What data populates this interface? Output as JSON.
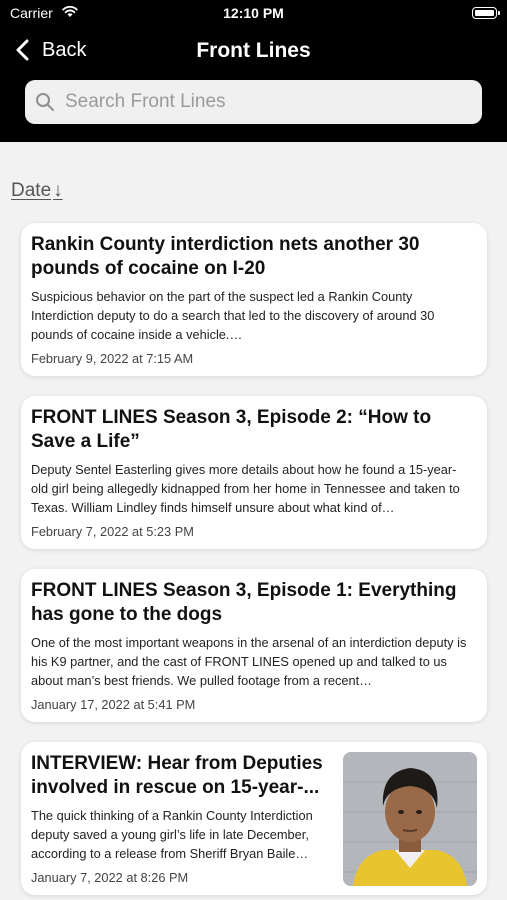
{
  "status_bar": {
    "carrier": "Carrier",
    "time": "12:10 PM"
  },
  "nav": {
    "back_label": "Back",
    "title": "Front Lines"
  },
  "search": {
    "placeholder": "Search Front Lines"
  },
  "sort": {
    "label": "Date",
    "arrow": "↓"
  },
  "articles": [
    {
      "title": "Rankin County interdiction nets another 30 pounds of cocaine on I-20",
      "summary": "Suspicious behavior on the part of the suspect led a Rankin County Interdiction deputy to do a search that led to the discovery of around 30 pounds of cocaine inside a vehicle.…",
      "date": "February 9, 2022 at 7:15 AM"
    },
    {
      "title": "FRONT LINES Season 3, Episode 2: “How to Save a Life”",
      "summary": "Deputy Sentel Easterling gives more details about how he found a 15-year-old girl being allegedly kidnapped from her home in Tennessee and taken to Texas. William Lindley finds himself unsure about what kind of…",
      "date": "February 7, 2022 at 5:23 PM"
    },
    {
      "title": "FRONT LINES Season 3, Episode 1: Everything has gone to the dogs",
      "summary": "One of the most important weapons in the arsenal of an interdiction deputy is his K9 partner, and the cast of FRONT LINES opened up and talked to us about man’s best friends. We pulled footage from a recent…",
      "date": "January 17, 2022 at 5:41 PM"
    },
    {
      "title": "INTERVIEW: Hear from Deputies involved in rescue on 15-year-...",
      "summary": "The quick thinking of a Rankin County Interdiction deputy saved a young girl’s life in late December, according to a release from Sheriff Bryan Baile…",
      "date": "January 7, 2022 at 8:26 PM"
    }
  ],
  "colors": {
    "header_bg": "#000000",
    "page_bg": "#f2f2f2",
    "card_bg": "#ffffff"
  }
}
